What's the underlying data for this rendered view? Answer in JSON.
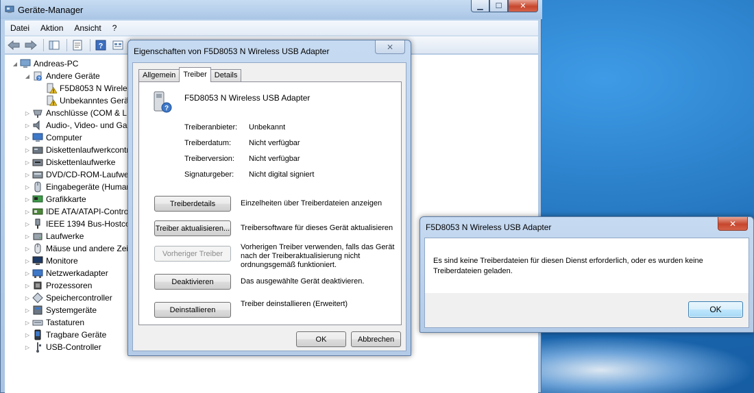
{
  "main_window": {
    "title": "Geräte-Manager",
    "menu": [
      "Datei",
      "Aktion",
      "Ansicht",
      "?"
    ]
  },
  "tree": {
    "root": "Andreas-PC",
    "items": [
      {
        "label": "Andere Geräte",
        "level": 1,
        "expanded": true,
        "icon": "other-devices-icon"
      },
      {
        "label": "F5D8053 N Wireless USB Adapter",
        "level": 2,
        "icon": "warning-device-icon"
      },
      {
        "label": "Unbekanntes Gerät",
        "level": 2,
        "icon": "warning-device-icon"
      },
      {
        "label": "Anschlüsse (COM & LPT)",
        "level": 1,
        "icon": "port-icon"
      },
      {
        "label": "Audio-, Video- und Gamecontroller",
        "level": 1,
        "icon": "audio-icon"
      },
      {
        "label": "Computer",
        "level": 1,
        "icon": "computer-icon"
      },
      {
        "label": "Diskettenlaufwerkcontroller",
        "level": 1,
        "icon": "floppy-controller-icon"
      },
      {
        "label": "Diskettenlaufwerke",
        "level": 1,
        "icon": "floppy-icon"
      },
      {
        "label": "DVD/CD-ROM-Laufwerke",
        "level": 1,
        "icon": "dvd-icon"
      },
      {
        "label": "Eingabegeräte (Human Interface Devices)",
        "level": 1,
        "icon": "hid-icon"
      },
      {
        "label": "Grafikkarte",
        "level": 1,
        "icon": "display-adapter-icon"
      },
      {
        "label": "IDE ATA/ATAPI-Controller",
        "level": 1,
        "icon": "ide-icon"
      },
      {
        "label": "IEEE 1394 Bus-Hostcontroller",
        "level": 1,
        "icon": "ieee1394-icon"
      },
      {
        "label": "Laufwerke",
        "level": 1,
        "icon": "disk-icon"
      },
      {
        "label": "Mäuse und andere Zeigegeräte",
        "level": 1,
        "icon": "mouse-icon"
      },
      {
        "label": "Monitore",
        "level": 1,
        "icon": "monitor-icon"
      },
      {
        "label": "Netzwerkadapter",
        "level": 1,
        "icon": "network-icon"
      },
      {
        "label": "Prozessoren",
        "level": 1,
        "icon": "processor-icon"
      },
      {
        "label": "Speichercontroller",
        "level": 1,
        "icon": "storage-controller-icon"
      },
      {
        "label": "Systemgeräte",
        "level": 1,
        "icon": "system-icon"
      },
      {
        "label": "Tastaturen",
        "level": 1,
        "icon": "keyboard-icon"
      },
      {
        "label": "Tragbare Geräte",
        "level": 1,
        "icon": "portable-icon"
      },
      {
        "label": "USB-Controller",
        "level": 1,
        "icon": "usb-icon"
      }
    ]
  },
  "properties_dialog": {
    "title": "Eigenschaften von F5D8053 N Wireless USB Adapter",
    "tabs": [
      "Allgemein",
      "Treiber",
      "Details"
    ],
    "active_tab": "Treiber",
    "device_name": "F5D8053 N Wireless USB Adapter",
    "props": [
      {
        "label": "Treiberanbieter:",
        "value": "Unbekannt"
      },
      {
        "label": "Treiberdatum:",
        "value": "Nicht verfügbar"
      },
      {
        "label": "Treiberversion:",
        "value": "Nicht verfügbar"
      },
      {
        "label": "Signaturgeber:",
        "value": "Nicht digital signiert"
      }
    ],
    "actions": [
      {
        "button": "Treiberdetails",
        "desc": "Einzelheiten über Treiberdateien anzeigen",
        "enabled": true
      },
      {
        "button": "Treiber aktualisieren...",
        "desc": "Treibersoftware für dieses Gerät aktualisieren",
        "enabled": true
      },
      {
        "button": "Vorheriger Treiber",
        "desc": "Vorherigen Treiber verwenden, falls das Gerät nach der Treiberaktualisierung nicht ordnungsgemäß funktioniert.",
        "enabled": false
      },
      {
        "button": "Deaktivieren",
        "desc": "Das ausgewählte Gerät deaktivieren.",
        "enabled": true
      },
      {
        "button": "Deinstallieren",
        "desc": "Treiber deinstallieren (Erweitert)",
        "enabled": true
      }
    ],
    "ok": "OK",
    "cancel": "Abbrechen"
  },
  "message_box": {
    "title": "F5D8053 N Wireless USB Adapter",
    "text": "Es sind keine Treiberdateien für diesen Dienst erforderlich, oder es wurden keine Treiberdateien geladen.",
    "ok": "OK"
  },
  "colors": {
    "title_bar": "#aac6e6",
    "close_red": "#c6472d",
    "desktop_blue": "#1c6ab3"
  }
}
